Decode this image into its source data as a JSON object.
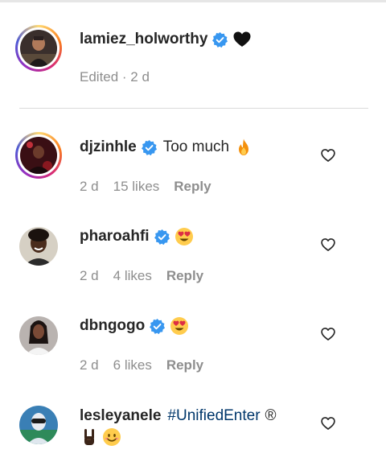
{
  "caption": {
    "username": "lamiez_holworthy",
    "verified": true,
    "emoji_icon": "black-heart-icon",
    "meta": "Edited · 2 d"
  },
  "comments": [
    {
      "username": "djzinhle",
      "verified": true,
      "text": "Too much",
      "emoji_icon": "fire-icon",
      "time": "2 d",
      "likes": "15 likes",
      "reply": "Reply"
    },
    {
      "username": "pharoahfi",
      "verified": true,
      "text": "",
      "emoji_icon": "heart-eyes-icon",
      "time": "2 d",
      "likes": "4 likes",
      "reply": "Reply"
    },
    {
      "username": "dbngogo",
      "verified": true,
      "text": "",
      "emoji_icon": "heart-eyes-icon",
      "time": "2 d",
      "likes": "6 likes",
      "reply": "Reply"
    },
    {
      "username": "lesleyanele",
      "verified": false,
      "hashtag": "#UnifiedEnter",
      "text_suffix": "®",
      "emoji_icons": [
        "rock-on-hand-icon",
        "smiling-face-icon"
      ]
    }
  ],
  "colors": {
    "verified_blue": "#3897f0",
    "hashtag": "#00376b",
    "muted": "#8e8e8e"
  }
}
